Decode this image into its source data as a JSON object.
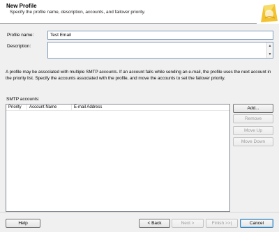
{
  "header": {
    "title": "New Profile",
    "subtitle": "Specify the profile name, description, accounts, and failover priority."
  },
  "form": {
    "profile_name_label": "Profile name:",
    "profile_name_value": "Test Email",
    "description_label": "Description:",
    "description_value": ""
  },
  "info_text": "A profile may be associated with multiple SMTP accounts. If an account fails while sending an e-mail, the profile uses the next account in the priority list. Specify the accounts associated with the profile, and move the accounts to set the failover priority.",
  "accounts": {
    "label": "SMTP accounts:",
    "columns": [
      "Priority",
      "Account Name",
      "E-mail Address"
    ],
    "rows": []
  },
  "side_buttons": {
    "add": "Add...",
    "remove": "Remove",
    "move_up": "Move Up",
    "move_down": "Move Down"
  },
  "footer": {
    "help": "Help",
    "back": "< Back",
    "next": "Next >",
    "finish": "Finish >>|",
    "cancel": "Cancel"
  },
  "colors": {
    "header_bg": "#ffffff",
    "dialog_bg": "#f0f0f0",
    "field_border": "#7f9db9",
    "logo_yellow": "#f2c230"
  },
  "icons": {
    "logo": "sql-server-logo-icon",
    "scroll_up": "scroll-up-arrow-icon",
    "scroll_down": "scroll-down-arrow-icon"
  }
}
